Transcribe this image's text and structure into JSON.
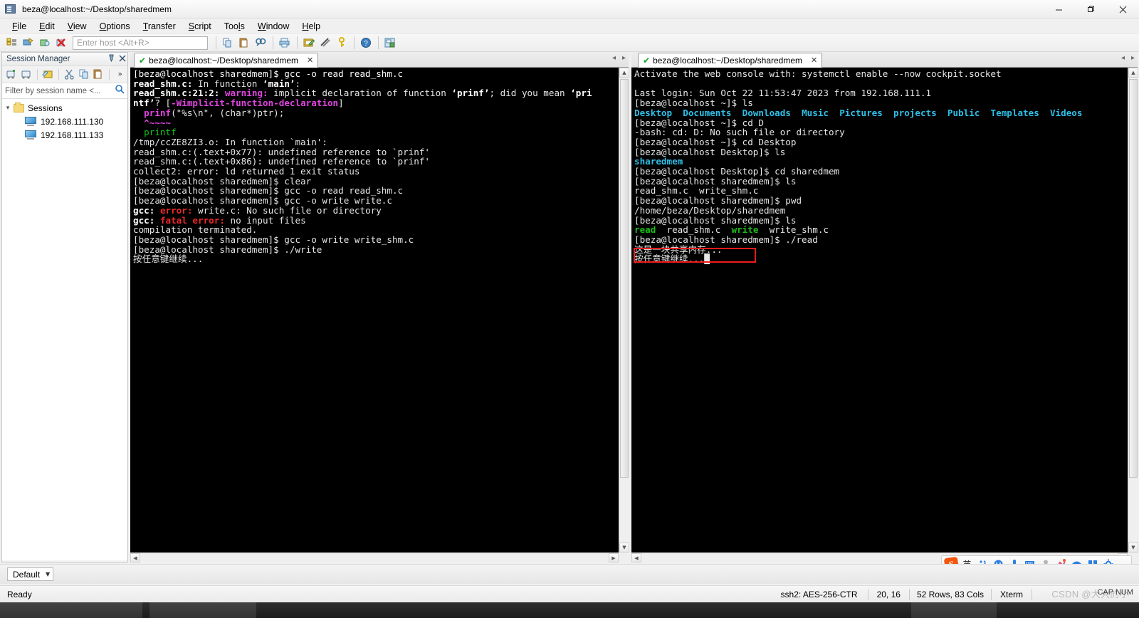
{
  "window": {
    "title": "beza@localhost:~/Desktop/sharedmem",
    "app_icon": "terminal-window-icon",
    "minimize": "—",
    "maximize": "❐",
    "close": "✕"
  },
  "menubar": {
    "items": [
      {
        "label": "File",
        "accel": "F"
      },
      {
        "label": "Edit",
        "accel": "E"
      },
      {
        "label": "View",
        "accel": "V"
      },
      {
        "label": "Options",
        "accel": "O"
      },
      {
        "label": "Transfer",
        "accel": "T"
      },
      {
        "label": "Script",
        "accel": "S"
      },
      {
        "label": "Tools",
        "accel": "l"
      },
      {
        "label": "Window",
        "accel": "W"
      },
      {
        "label": "Help",
        "accel": "H"
      }
    ]
  },
  "toolbar": {
    "host_placeholder": "Enter host <Alt+R>",
    "buttons": [
      "session-manager-icon",
      "connect-icon",
      "connect-in-tab-icon",
      "disconnect-icon",
      "copy-icon",
      "paste-icon",
      "find-icon",
      "print-icon",
      "log-session-icon",
      "clear-screen-icon",
      "key-icon",
      "help-icon",
      "options-icon"
    ]
  },
  "session_manager": {
    "title": "Session Manager",
    "pin_icon": "pin-icon",
    "close_icon": "close-icon",
    "toolbar_buttons": [
      "new-session-icon",
      "new-folder-icon",
      "connect-session-icon",
      "cut-icon",
      "copy-icon",
      "paste-icon",
      "overflow-icon"
    ],
    "filter_placeholder": "Filter by session name <...",
    "search_icon": "search-icon",
    "tree": {
      "root": {
        "label": "Sessions",
        "expanded": true,
        "icon": "folder-icon"
      },
      "children": [
        {
          "label": "192.168.111.130",
          "icon": "computer-icon"
        },
        {
          "label": "192.168.111.133",
          "icon": "computer-icon"
        }
      ]
    }
  },
  "left_pane": {
    "tab": {
      "label": "beza@localhost:~/Desktop/sharedmem",
      "status_icon": "green-check-icon",
      "close_icon": "close-icon"
    },
    "tab_arrows": [
      "prev-tab-arrow",
      "next-tab-arrow"
    ],
    "terminal_lines": [
      [
        {
          "t": "[beza@localhost sharedmem]$ gcc -o read read_shm.c",
          "c": "white"
        }
      ],
      [
        {
          "t": "read_shm.c:",
          "c": "white",
          "b": true
        },
        {
          "t": " In function ",
          "c": ""
        },
        {
          "t": "‘main’",
          "c": "white",
          "b": true
        },
        {
          "t": ":",
          "c": ""
        }
      ],
      [
        {
          "t": "read_shm.c:21:2:",
          "c": "white",
          "b": true
        },
        {
          "t": " ",
          "c": ""
        },
        {
          "t": "warning:",
          "c": "magenta",
          "b": true
        },
        {
          "t": " implicit declaration of function ",
          "c": ""
        },
        {
          "t": "‘prinf’",
          "c": "white",
          "b": true
        },
        {
          "t": "; did you mean ",
          "c": ""
        },
        {
          "t": "‘pri",
          "c": "white",
          "b": true
        }
      ],
      [
        {
          "t": "ntf’",
          "c": "white",
          "b": true
        },
        {
          "t": "? [",
          "c": ""
        },
        {
          "t": "-Wimplicit-function-declaration",
          "c": "magenta",
          "b": true
        },
        {
          "t": "]",
          "c": ""
        }
      ],
      [
        {
          "t": "  ",
          "c": ""
        },
        {
          "t": "prinf",
          "c": "magenta",
          "b": true
        },
        {
          "t": "(\"%s\\n\", (char*)ptr);",
          "c": ""
        }
      ],
      [
        {
          "t": "  ",
          "c": ""
        },
        {
          "t": "^~~~~",
          "c": "magenta",
          "b": true
        }
      ],
      [
        {
          "t": "  ",
          "c": ""
        },
        {
          "t": "printf",
          "c": "green"
        }
      ],
      [
        {
          "t": "/tmp/ccZE8ZI3.o: In function `main':",
          "c": ""
        }
      ],
      [
        {
          "t": "read_shm.c:(.text+0x77): undefined reference to `prinf'",
          "c": ""
        }
      ],
      [
        {
          "t": "read_shm.c:(.text+0x86): undefined reference to `prinf'",
          "c": ""
        }
      ],
      [
        {
          "t": "collect2: error: ld returned 1 exit status",
          "c": ""
        }
      ],
      [
        {
          "t": "[beza@localhost sharedmem]$ clear",
          "c": ""
        }
      ],
      [
        {
          "t": "[beza@localhost sharedmem]$ gcc -o read read_shm.c",
          "c": ""
        }
      ],
      [
        {
          "t": "[beza@localhost sharedmem]$ gcc -o write write.c",
          "c": ""
        }
      ],
      [
        {
          "t": "gcc:",
          "c": "white",
          "b": true
        },
        {
          "t": " ",
          "c": ""
        },
        {
          "t": "error:",
          "c": "red",
          "b": true
        },
        {
          "t": " write.c: No such file or directory",
          "c": ""
        }
      ],
      [
        {
          "t": "gcc:",
          "c": "white",
          "b": true
        },
        {
          "t": " ",
          "c": ""
        },
        {
          "t": "fatal error:",
          "c": "red",
          "b": true
        },
        {
          "t": " no input files",
          "c": ""
        }
      ],
      [
        {
          "t": "compilation terminated.",
          "c": ""
        }
      ],
      [
        {
          "t": "[beza@localhost sharedmem]$ gcc -o write write_shm.c",
          "c": ""
        }
      ],
      [
        {
          "t": "[beza@localhost sharedmem]$ ./write",
          "c": ""
        }
      ],
      [
        {
          "t": "按任意键继续...",
          "c": ""
        }
      ]
    ]
  },
  "right_pane": {
    "tab": {
      "label": "beza@localhost:~/Desktop/sharedmem",
      "status_icon": "green-check-icon",
      "close_icon": "close-icon"
    },
    "tab_arrows": [
      "prev-tab-arrow",
      "next-tab-arrow"
    ],
    "terminal_lines": [
      [
        {
          "t": "Activate the web console with: systemctl enable --now cockpit.socket",
          "c": ""
        }
      ],
      [
        {
          "t": "",
          "c": ""
        }
      ],
      [
        {
          "t": "Last login: Sun Oct 22 11:53:47 2023 from 192.168.111.1",
          "c": ""
        }
      ],
      [
        {
          "t": "[beza@localhost ~]$ ls",
          "c": ""
        }
      ],
      [
        {
          "t": "Desktop",
          "c": "cyan",
          "b": true
        },
        {
          "t": "  ",
          "c": ""
        },
        {
          "t": "Documents",
          "c": "cyan",
          "b": true
        },
        {
          "t": "  ",
          "c": ""
        },
        {
          "t": "Downloads",
          "c": "cyan",
          "b": true
        },
        {
          "t": "  ",
          "c": ""
        },
        {
          "t": "Music",
          "c": "cyan",
          "b": true
        },
        {
          "t": "  ",
          "c": ""
        },
        {
          "t": "Pictures",
          "c": "cyan",
          "b": true
        },
        {
          "t": "  ",
          "c": ""
        },
        {
          "t": "projects",
          "c": "cyan",
          "b": true
        },
        {
          "t": "  ",
          "c": ""
        },
        {
          "t": "Public",
          "c": "cyan",
          "b": true
        },
        {
          "t": "  ",
          "c": ""
        },
        {
          "t": "Templates",
          "c": "cyan",
          "b": true
        },
        {
          "t": "  ",
          "c": ""
        },
        {
          "t": "Videos",
          "c": "cyan",
          "b": true
        }
      ],
      [
        {
          "t": "[beza@localhost ~]$ cd D",
          "c": ""
        }
      ],
      [
        {
          "t": "-bash: cd: D: No such file or directory",
          "c": ""
        }
      ],
      [
        {
          "t": "[beza@localhost ~]$ cd Desktop",
          "c": ""
        }
      ],
      [
        {
          "t": "[beza@localhost Desktop]$ ls",
          "c": ""
        }
      ],
      [
        {
          "t": "sharedmem",
          "c": "cyan",
          "b": true
        }
      ],
      [
        {
          "t": "[beza@localhost Desktop]$ cd sharedmem",
          "c": ""
        }
      ],
      [
        {
          "t": "[beza@localhost sharedmem]$ ls",
          "c": ""
        }
      ],
      [
        {
          "t": "read_shm.c  write_shm.c",
          "c": ""
        }
      ],
      [
        {
          "t": "[beza@localhost sharedmem]$ pwd",
          "c": ""
        }
      ],
      [
        {
          "t": "/home/beza/Desktop/sharedmem",
          "c": ""
        }
      ],
      [
        {
          "t": "[beza@localhost sharedmem]$ ls",
          "c": ""
        }
      ],
      [
        {
          "t": "read",
          "c": "green",
          "b": true
        },
        {
          "t": "  read_shm.c  ",
          "c": ""
        },
        {
          "t": "write",
          "c": "green",
          "b": true
        },
        {
          "t": "  write_shm.c",
          "c": ""
        }
      ],
      [
        {
          "t": "[beza@localhost sharedmem]$ ./read",
          "c": ""
        }
      ],
      [
        {
          "t": "这是一块共享内存...",
          "c": ""
        }
      ],
      [
        {
          "t": "按任意键继续...█",
          "c": ""
        }
      ]
    ]
  },
  "annotation": {
    "color": "#ee1c1c",
    "label": "highlight-rectangle-around-shared-memory-output"
  },
  "bottom_bar": {
    "tab_label": "Default",
    "dropdown_icon": "chevron-down-icon"
  },
  "statusbar": {
    "ready": "Ready",
    "cipher": "ssh2: AES-256-CTR",
    "cursor": "20, 16",
    "dimensions": "52 Rows, 83 Cols",
    "emulation": "Xterm",
    "caps": "CAP NUM",
    "watermark": "CSDN @大大的小"
  },
  "ime": {
    "logo": "S",
    "buttons": [
      {
        "icon": "chinese-mode-label",
        "glyph": "英"
      },
      {
        "icon": "punctuation-icon",
        "glyph": "•,"
      },
      {
        "icon": "emoji-icon",
        "glyph": "☺"
      },
      {
        "icon": "microphone-icon",
        "glyph": "⬤"
      },
      {
        "icon": "keyboard-icon",
        "glyph": "⌨"
      },
      {
        "icon": "user-icon",
        "glyph": "●"
      },
      {
        "icon": "skin-icon",
        "glyph": "✦"
      },
      {
        "icon": "umbrella-icon",
        "glyph": "☂"
      },
      {
        "icon": "toolbox-icon",
        "glyph": "▦"
      },
      {
        "icon": "settings-icon",
        "glyph": "⚙"
      }
    ]
  },
  "colors": {
    "terminal_bg": "#000000",
    "terminal_fg": "#e6e6e6",
    "accent_green": "#18c018",
    "accent_cyan": "#2fc0e8",
    "accent_magenta": "#e044e0",
    "accent_red": "#ef2929",
    "annotation_red": "#ee1c1c"
  }
}
